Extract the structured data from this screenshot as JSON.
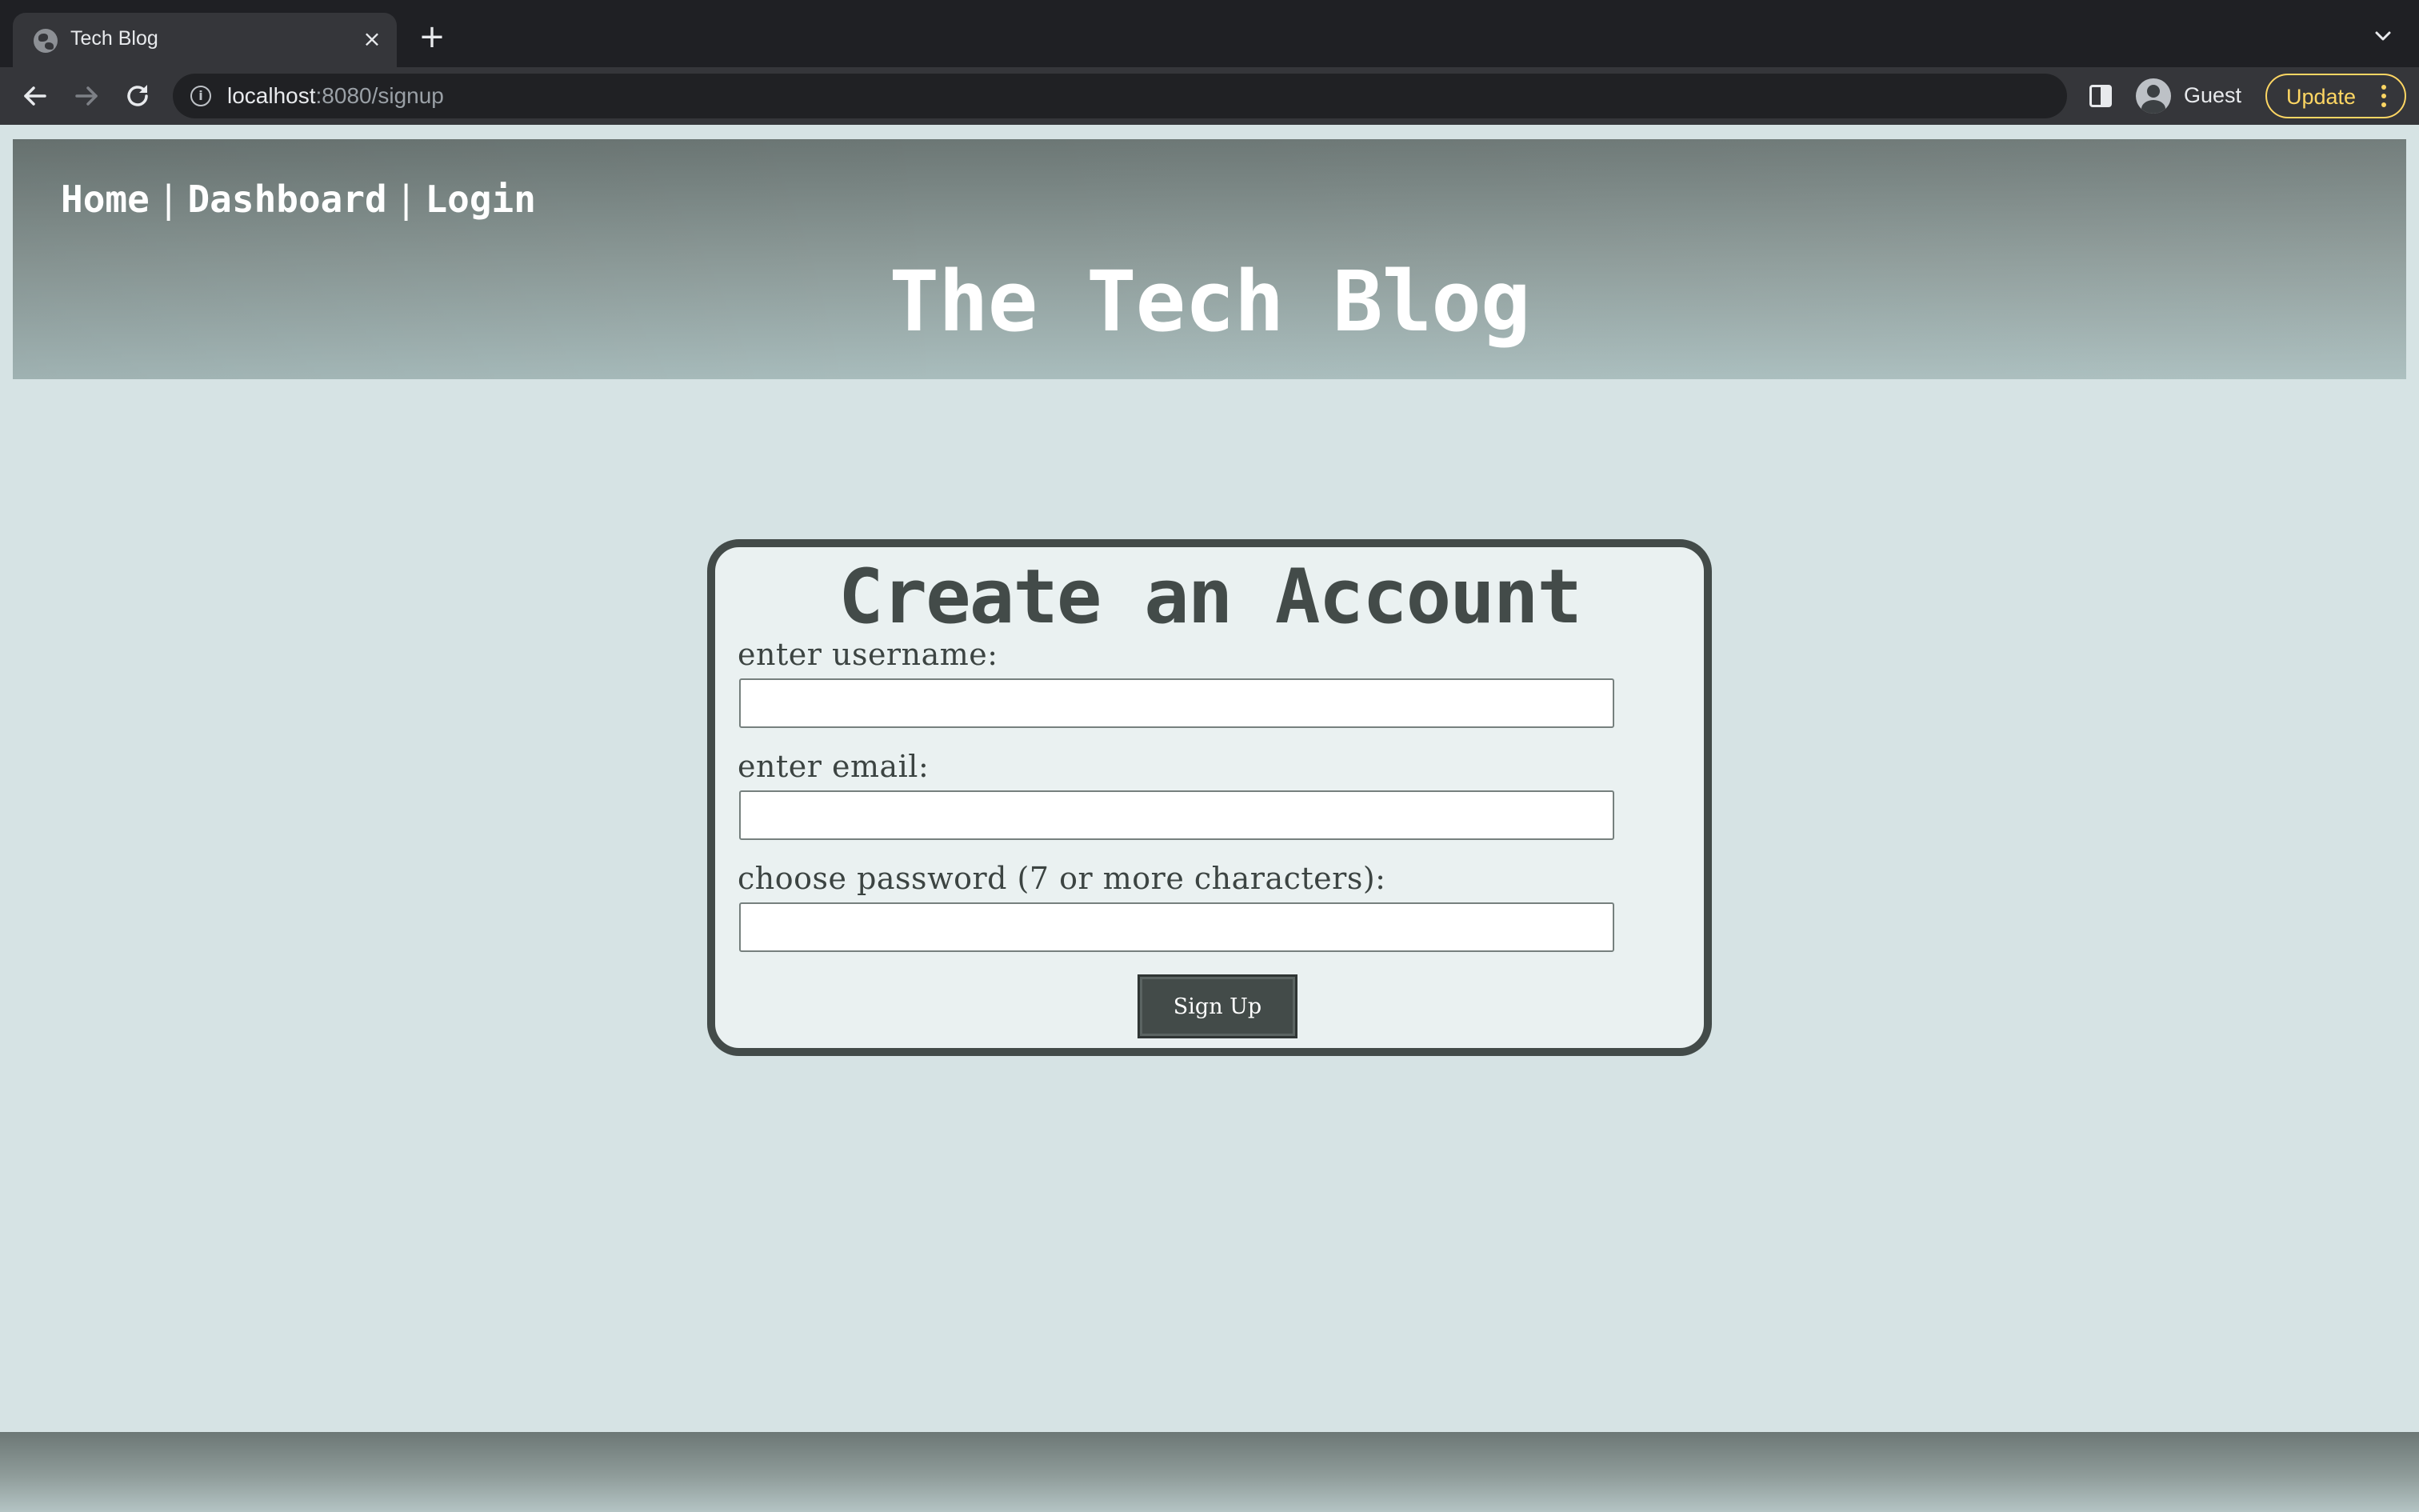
{
  "browser": {
    "tab": {
      "title": "Tech Blog",
      "favicon": "globe-icon",
      "close": "×"
    },
    "new_tab": "+",
    "address_bar": {
      "host": "localhost",
      "path": ":8080/signup"
    },
    "profile": {
      "name": "Guest"
    },
    "update_label": "Update",
    "colors": {
      "chrome": "#202124",
      "toolbar": "#35363a",
      "update_accent": "#fdd663"
    }
  },
  "site": {
    "nav": {
      "home": "Home",
      "separator": "|",
      "dashboard": "Dashboard",
      "login": "Login"
    },
    "title": "The Tech Blog"
  },
  "signup_form": {
    "heading": "Create an Account",
    "username_label": "enter username:",
    "username_value": "",
    "email_label": "enter email:",
    "email_value": "",
    "password_label": "choose password (7 or more characters):",
    "password_value": "",
    "submit_label": "Sign Up"
  },
  "colors": {
    "page_background": "#d6e3e4",
    "card_background": "#eaf1f1",
    "card_border": "#434b49",
    "header_gradient_top": "#6c7775",
    "header_gradient_bottom": "#a9bdbd"
  }
}
